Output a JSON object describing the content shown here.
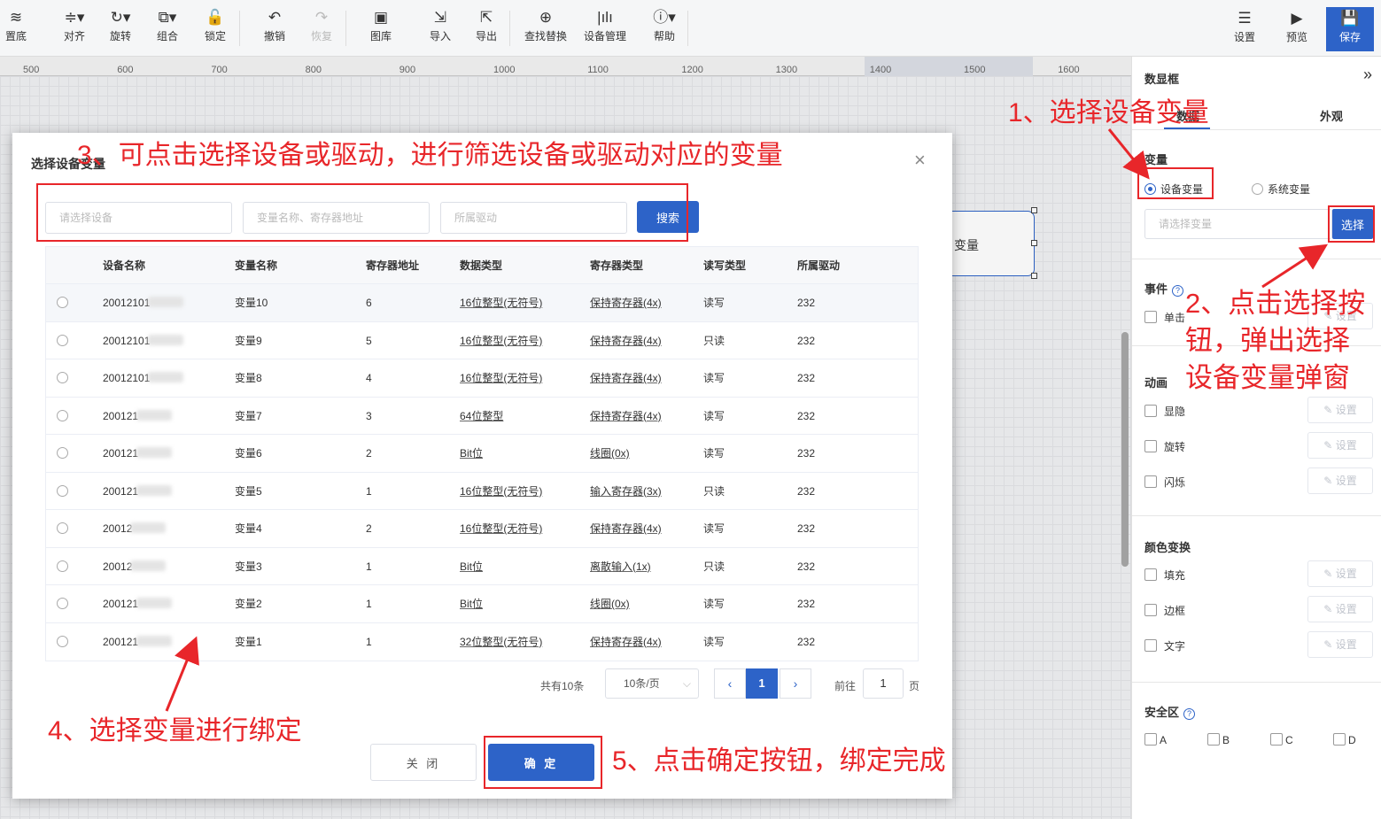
{
  "toolbar": {
    "items": [
      {
        "label": "置底",
        "icon": "layers-icon",
        "glyph": "≋"
      },
      {
        "label": "对齐",
        "icon": "align-icon",
        "glyph": "≑▾"
      },
      {
        "label": "旋转",
        "icon": "rotate-icon",
        "glyph": "↻▾"
      },
      {
        "label": "组合",
        "icon": "group-icon",
        "glyph": "⧉▾"
      },
      {
        "label": "锁定",
        "icon": "lock-icon",
        "glyph": "🔓"
      },
      {
        "label": "撤销",
        "icon": "undo-icon",
        "glyph": "↶"
      },
      {
        "label": "恢复",
        "icon": "redo-icon",
        "glyph": "↷"
      },
      {
        "label": "图库",
        "icon": "gallery-icon",
        "glyph": "▣"
      },
      {
        "label": "导入",
        "icon": "import-icon",
        "glyph": "⇲"
      },
      {
        "label": "导出",
        "icon": "export-icon",
        "glyph": "⇱"
      },
      {
        "label": "查找替换",
        "icon": "find-replace-icon",
        "glyph": "⊕"
      },
      {
        "label": "设备管理",
        "icon": "device-manage-icon",
        "glyph": "|ılı"
      },
      {
        "label": "帮助",
        "icon": "help-icon",
        "glyph": "ⓘ▾"
      }
    ],
    "right": [
      {
        "label": "设置",
        "icon": "settings-icon",
        "glyph": "☰"
      },
      {
        "label": "预览",
        "icon": "preview-icon",
        "glyph": "▶"
      },
      {
        "label": "保存",
        "icon": "save-icon",
        "glyph": "💾"
      }
    ]
  },
  "ruler": [
    "500",
    "600",
    "700",
    "800",
    "900",
    "1000",
    "1100",
    "1200",
    "1300",
    "1400",
    "1500",
    "1600"
  ],
  "canvas": {
    "box_label": "变量"
  },
  "panel": {
    "title": "数显框",
    "collapse": "»",
    "tabs": [
      "数据",
      "外观"
    ],
    "variable_section": "变量",
    "radio_device": "设备变量",
    "radio_system": "系统变量",
    "input_placeholder": "请选择变量",
    "select_button": "选择",
    "event_section": "事件",
    "event_click": "单击",
    "set_label": "设置",
    "animation_section": "动画",
    "anim_items": [
      "显隐",
      "旋转",
      "闪烁"
    ],
    "color_section": "颜色变换",
    "color_items": [
      "填充",
      "边框",
      "文字"
    ],
    "safe_section": "安全区",
    "safe_items": [
      "A",
      "B",
      "C",
      "D"
    ]
  },
  "dialog": {
    "title": "选择设备变量",
    "close": "×",
    "filters": {
      "device_placeholder": "请选择设备",
      "variable_placeholder": "变量名称、寄存器地址",
      "driver_placeholder": "所属驱动",
      "search_button": "搜索"
    },
    "table": {
      "headers": [
        "设备名称",
        "变量名称",
        "寄存器地址",
        "数据类型",
        "寄存器类型",
        "读写类型",
        "所属驱动"
      ],
      "rows": [
        {
          "device": "20012101",
          "name": "变量10",
          "addr": "6",
          "dtype": "16位整型(无符号)",
          "rtype": "保持寄存器(4x)",
          "rw": "读写",
          "driver": "232"
        },
        {
          "device": "20012101",
          "name": "变量9",
          "addr": "5",
          "dtype": "16位整型(无符号)",
          "rtype": "保持寄存器(4x)",
          "rw": "只读",
          "driver": "232"
        },
        {
          "device": "20012101",
          "name": "变量8",
          "addr": "4",
          "dtype": "16位整型(无符号)",
          "rtype": "保持寄存器(4x)",
          "rw": "读写",
          "driver": "232"
        },
        {
          "device": "200121",
          "name": "变量7",
          "addr": "3",
          "dtype": "64位整型",
          "rtype": "保持寄存器(4x)",
          "rw": "读写",
          "driver": "232"
        },
        {
          "device": "200121",
          "name": "变量6",
          "addr": "2",
          "dtype": "Bit位",
          "rtype": "线圈(0x)",
          "rw": "读写",
          "driver": "232"
        },
        {
          "device": "200121",
          "name": "变量5",
          "addr": "1",
          "dtype": "16位整型(无符号)",
          "rtype": "输入寄存器(3x)",
          "rw": "只读",
          "driver": "232"
        },
        {
          "device": "20012",
          "name": "变量4",
          "addr": "2",
          "dtype": "16位整型(无符号)",
          "rtype": "保持寄存器(4x)",
          "rw": "读写",
          "driver": "232"
        },
        {
          "device": "20012",
          "name": "变量3",
          "addr": "1",
          "dtype": "Bit位",
          "rtype": "离散输入(1x)",
          "rw": "只读",
          "driver": "232"
        },
        {
          "device": "200121",
          "name": "变量2",
          "addr": "1",
          "dtype": "Bit位",
          "rtype": "线圈(0x)",
          "rw": "读写",
          "driver": "232"
        },
        {
          "device": "200121",
          "name": "变量1",
          "addr": "1",
          "dtype": "32位整型(无符号)",
          "rtype": "保持寄存器(4x)",
          "rw": "读写",
          "driver": "232"
        }
      ]
    },
    "pagination": {
      "total": "共有10条",
      "page_size": "10条/页",
      "prev": "‹",
      "current": "1",
      "next": "›",
      "goto": "前往",
      "goto_value": "1",
      "page": "页"
    },
    "close_button": "关 闭",
    "confirm_button": "确 定"
  },
  "annotations": {
    "a1": "1、选择设备变量",
    "a2_l1": "2、点击选择按",
    "a2_l2": "钮，弹出选择",
    "a2_l3": "设备变量弹窗",
    "a3": "3、可点击选择设备或驱动，进行筛选设备或驱动对应的变量",
    "a4": "4、选择变量进行绑定",
    "a5": "5、点击确定按钮，绑定完成"
  },
  "colors": {
    "accent": "#2d63c8",
    "annotation": "#e8262a"
  }
}
